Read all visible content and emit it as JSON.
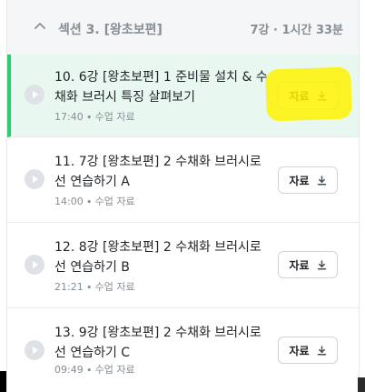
{
  "section": {
    "title": "섹션 3. [왕초보편]",
    "meta": "7강 ∙ 1시간 33분"
  },
  "lessons": [
    {
      "title": "10. 6강 [왕초보편] 1 준비물 설치 & 수채화 브러시 특징 살펴보기",
      "duration": "17:40",
      "sep": "∙",
      "type": "수업 자료",
      "button": "자료",
      "active": true
    },
    {
      "title": "11. 7강 [왕초보편] 2 수채화 브러시로 선 연습하기 A",
      "duration": "14:00",
      "sep": "∙",
      "type": "수업 자료",
      "button": "자료",
      "active": false
    },
    {
      "title": "12. 8강 [왕초보편] 2 수채화 브러시로 선 연습하기 B",
      "duration": "21:21",
      "sep": "∙",
      "type": "수업 자료",
      "button": "자료",
      "active": false
    },
    {
      "title": "13. 9강 [왕초보편] 2 수채화 브러시로 선 연습하기 C",
      "duration": "09:49",
      "sep": "∙",
      "type": "수업 자료",
      "button": "자료",
      "active": false
    }
  ],
  "icons": {
    "collapse": "chevron-up-icon",
    "play": "play-circle-icon",
    "download": "download-icon"
  },
  "colors": {
    "active_bg": "#e8f8f0",
    "active_accent": "#2ecc71",
    "highlight": "#fff200"
  }
}
